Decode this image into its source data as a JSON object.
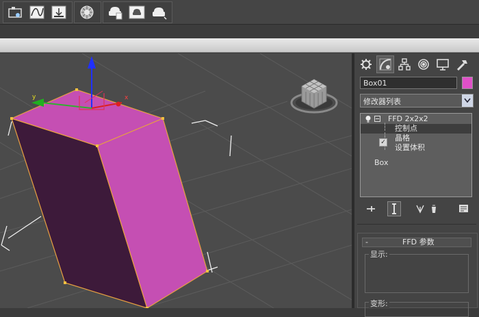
{
  "toolbar": {
    "buttons": [
      "schematic-view-icon",
      "curve-editor-icon",
      "render-setup-icon",
      "material-editor-icon",
      "rendered-frame-icon",
      "render-production-icon",
      "render-teapot-icon"
    ]
  },
  "viewport": {
    "gizmo_axes": {
      "x": "x",
      "y": "y",
      "z": "z"
    },
    "object_color": "#c54fb3",
    "object_dark_color": "#3e1a3a"
  },
  "command_panel": {
    "tabs": [
      "create-tab",
      "modify-tab",
      "hierarchy-tab",
      "motion-tab",
      "display-tab",
      "utilities-tab"
    ],
    "object_name": "Box01",
    "object_color": "#e050c8",
    "modifier_list_label": "修改器列表",
    "stack": {
      "modifier": "FFD 2x2x2",
      "sub_items": [
        "控制点",
        "晶格",
        "设置体积"
      ],
      "base": "Box",
      "selected_index": 0
    },
    "rollout": {
      "toggle": "-",
      "title": "FFD 参数",
      "display_label": "显示:",
      "deform_label": "变形:"
    }
  }
}
